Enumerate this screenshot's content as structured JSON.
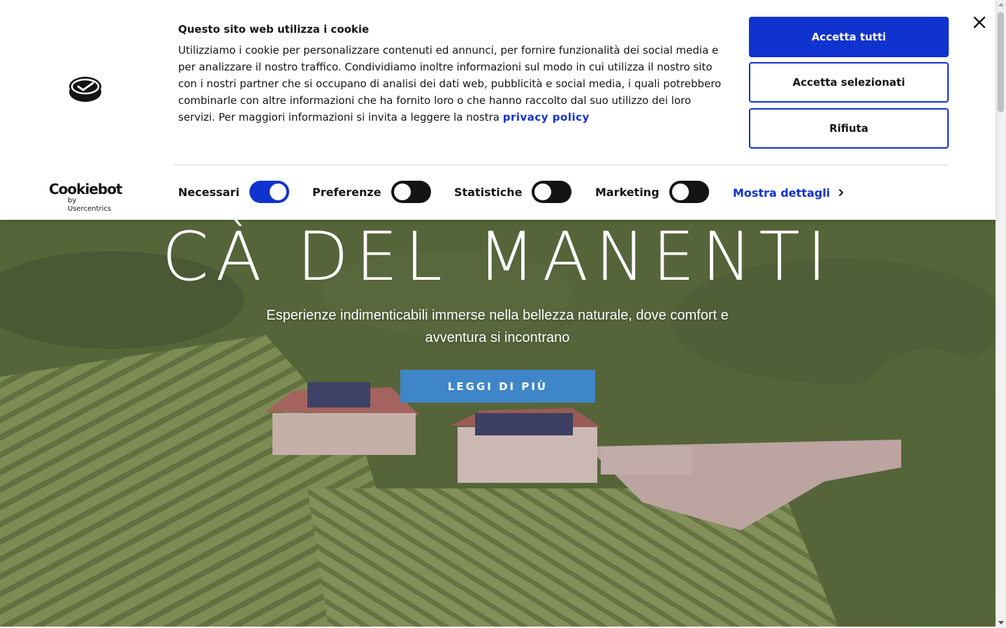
{
  "hero": {
    "title": "CÀ DEL MANENTI",
    "subtitle": "Esperienze indimenticabili immerse nella bellezza naturale, dove comfort e avventura si incontrano",
    "cta_label": "LEGGI DI PIÙ",
    "cta_color": "#3f86c8",
    "background_description_icon": "aerial-vineyard-photo"
  },
  "cookie_banner": {
    "logo_icon": "cookiebot-consent-icon",
    "brand_name": "Cookiebot",
    "brand_sub": "by Usercentrics",
    "title": "Questo sito web utilizza i cookie",
    "body": "Utilizziamo i cookie per personalizzare contenuti ed annunci, per fornire funzionalità dei social media e per analizzare il nostro traffico. Condividiamo inoltre informazioni sul modo in cui utilizza il nostro sito con i nostri partner che si occupano di analisi dei dati web, pubblicità e social media, i quali potrebbero combinarle con altre informazioni che ha fornito loro o che hanno raccolto dal suo utilizzo dei loro servizi. Per maggiori informazioni si invita a leggere la nostra",
    "privacy_link": "privacy policy",
    "buttons": {
      "accept_all": "Accetta tutti",
      "accept_selected": "Accetta selezionati",
      "reject": "Rifiuta"
    },
    "consents": [
      {
        "label": "Necessari",
        "checked": true
      },
      {
        "label": "Preferenze",
        "checked": false
      },
      {
        "label": "Statistiche",
        "checked": false
      },
      {
        "label": "Marketing",
        "checked": false
      }
    ],
    "details_link": "Mostra dettagli",
    "accent_color": "#1032cf",
    "close_icon": "close-icon"
  }
}
